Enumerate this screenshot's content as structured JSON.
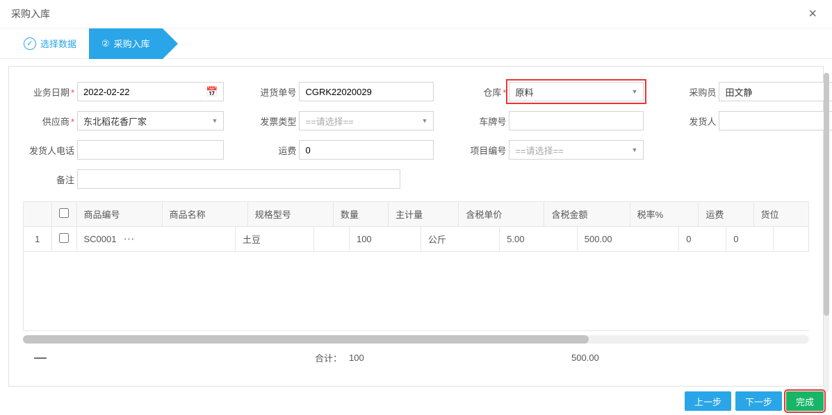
{
  "modal": {
    "title": "采购入库"
  },
  "steps": {
    "step1": {
      "label": "选择数据"
    },
    "step2": {
      "num": "②",
      "label": "采购入库"
    }
  },
  "form": {
    "biz_date": {
      "label": "业务日期",
      "value": "2022-02-22"
    },
    "stock_no": {
      "label": "进货单号",
      "value": "CGRK22020029"
    },
    "warehouse": {
      "label": "仓库",
      "value": "原料"
    },
    "purchaser": {
      "label": "采购员",
      "value": "田文静"
    },
    "supplier": {
      "label": "供应商",
      "value": "东北稻花香厂家"
    },
    "invoice": {
      "label": "发票类型",
      "placeholder": "==请选择=="
    },
    "plate": {
      "label": "车牌号",
      "value": ""
    },
    "shipper": {
      "label": "发货人",
      "value": ""
    },
    "shipper_tel": {
      "label": "发货人电话",
      "value": ""
    },
    "freight": {
      "label": "运费",
      "value": "0"
    },
    "project_no": {
      "label": "项目编号",
      "placeholder": "==请选择=="
    },
    "remark": {
      "label": "备注",
      "value": ""
    }
  },
  "table": {
    "headers": {
      "code": "商品编号",
      "name": "商品名称",
      "spec": "规格型号",
      "qty": "数量",
      "unit": "主计量",
      "price": "含税单价",
      "amount": "含税金额",
      "tax": "税率%",
      "freight": "运费",
      "loc": "货位"
    },
    "rows": [
      {
        "idx": "1",
        "code": "SC0001",
        "name": "土豆",
        "spec": "",
        "qty": "100",
        "unit": "公斤",
        "price": "5.00",
        "amount": "500.00",
        "tax": "0",
        "freight": "0",
        "loc": ""
      }
    ],
    "totals": {
      "label": "合计：",
      "qty": "100",
      "amount": "500.00"
    }
  },
  "footer": {
    "prev": "上一步",
    "next": "下一步",
    "done": "完成"
  }
}
